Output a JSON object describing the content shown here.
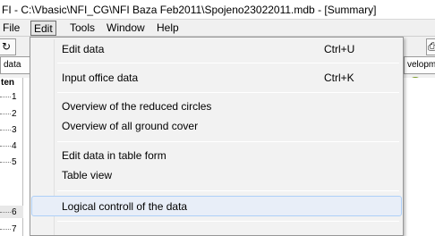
{
  "window": {
    "title": "FI - C:\\Vbasic\\NFI_CG\\NFI Baza Feb2011\\Spojeno23022011.mdb - [Summary]"
  },
  "menubar": {
    "items": [
      {
        "label": "File"
      },
      {
        "label": "Edit"
      },
      {
        "label": "Tools"
      },
      {
        "label": "Window"
      },
      {
        "label": "Help"
      }
    ]
  },
  "toolbar": {
    "tab_left_label": "data",
    "tab_right_label": "velopm"
  },
  "tree": {
    "header": "ten",
    "numbers": [
      "1",
      "2",
      "3",
      "4",
      "5",
      "6",
      "7"
    ]
  },
  "edit_menu": {
    "items": [
      {
        "label": "Edit data",
        "shortcut": "Ctrl+U"
      },
      {
        "label": "Input office data",
        "shortcut": "Ctrl+K"
      },
      {
        "label": "Overview of the reduced circles",
        "shortcut": ""
      },
      {
        "label": "Overview of all ground cover",
        "shortcut": ""
      },
      {
        "label": "Edit data in table form",
        "shortcut": ""
      },
      {
        "label": "Table view",
        "shortcut": ""
      },
      {
        "label": "Logical controll of the data",
        "shortcut": ""
      }
    ]
  },
  "colors": {
    "menu_bg": "#f2f2f2",
    "hover_bg": "#e8eef8",
    "hover_border": "#aecff7"
  }
}
